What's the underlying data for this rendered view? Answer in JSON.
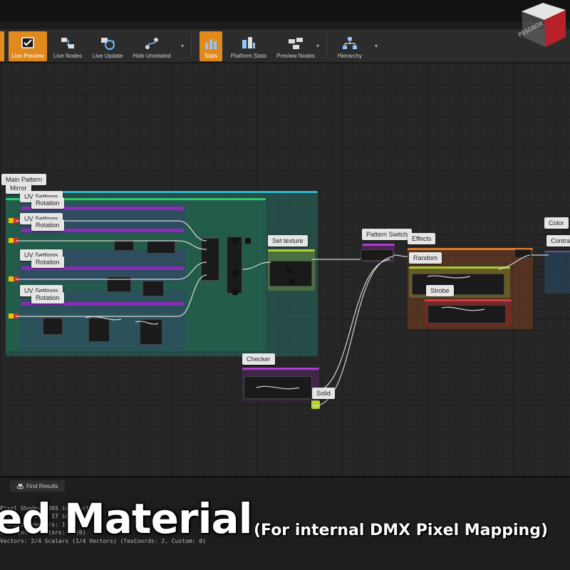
{
  "toolbar": {
    "items": [
      {
        "label": "Live Preview",
        "icon": "checkbox-icon"
      },
      {
        "label": "Live Nodes",
        "icon": "live-nodes-icon"
      },
      {
        "label": "Live Update",
        "icon": "live-update-icon"
      },
      {
        "label": "Hide Unrelated",
        "icon": "hide-unrelated-icon"
      },
      {
        "label": "Stats",
        "icon": "stats-icon"
      },
      {
        "label": "Platform Stats",
        "icon": "platform-stats-icon"
      },
      {
        "label": "Preview Nodes",
        "icon": "preview-nodes-icon"
      },
      {
        "label": "Hierarchy",
        "icon": "hierarchy-icon"
      }
    ]
  },
  "graph": {
    "comments": {
      "main_pattern": "Main Pattern",
      "mirror": "Mirror",
      "uv1": "UV Settings",
      "rot1": "Rotation",
      "uv2": "UV Settings",
      "rot2": "Rotation",
      "uv3": "UV Settings",
      "rot3": "Rotation",
      "uv4": "UV Settings",
      "rot4": "Rotation",
      "set_texture": "Set texture",
      "pattern_switch": "Pattern Switch",
      "effects": "Effects",
      "random": "Random",
      "strobe": "Strobe",
      "color": "Color",
      "contrast": "Contra",
      "checker": "Checker",
      "solid": "Solid"
    }
  },
  "bottom_panel": {
    "tab_label": "Find Results",
    "stats_lines": [
      "Pixel Shader: 465 instructions",
      "Vertex Shader: 17 instructions",
      "Texture samplers: 1",
      "User interpolators: 2/(0)",
      "Vectors: 2/4 Scalars (1/4 Vectors) (TexCoords: 2, Custom: 0)"
    ]
  },
  "overlay": {
    "headline": "ed Material",
    "subheadline": "(For internal DMX Pixel Mapping)"
  },
  "watermark": {
    "text": "PSSGBOX"
  },
  "colors": {
    "accent": "#e08a1e",
    "main_frame": "#1f5f57",
    "effects_frame": "#5a3a22",
    "param_bar": "#8a2bb8",
    "graph_bg": "#262626"
  }
}
